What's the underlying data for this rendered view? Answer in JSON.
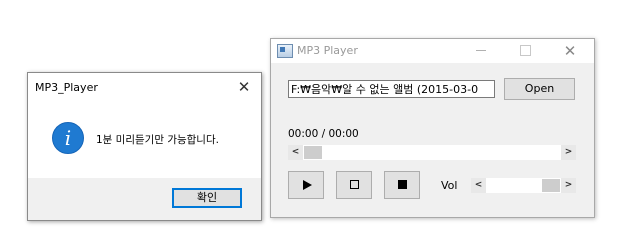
{
  "message_box": {
    "title": "MP3_Player",
    "close_glyph": "✕",
    "icon": "info-icon",
    "icon_glyph": "i",
    "message": "1분 미리듣기만 가능합니다.",
    "ok_label": "확인"
  },
  "player": {
    "title": "MP3 Player",
    "minimize_icon": "minimize-icon",
    "maximize_icon": "maximize-icon",
    "close_glyph": "✕",
    "file_path": "F:₩음악₩알 수 없는 앨범 (2015-03-0",
    "open_label": "Open",
    "time_text": "00:00 / 00:00",
    "seek_left_arrow": "<",
    "seek_right_arrow": ">",
    "seek_position": 0,
    "play_icon": "play-icon",
    "pause_icon": "pause-icon",
    "stop_icon": "stop-icon",
    "volume_label": "Vol",
    "volume_left_arrow": "<",
    "volume_right_arrow": ">",
    "volume_level": 0.85
  },
  "colors": {
    "info_icon": "#1f7ad1",
    "default_button_border": "#0078d7",
    "dialog_background": "#f0f0f0"
  }
}
